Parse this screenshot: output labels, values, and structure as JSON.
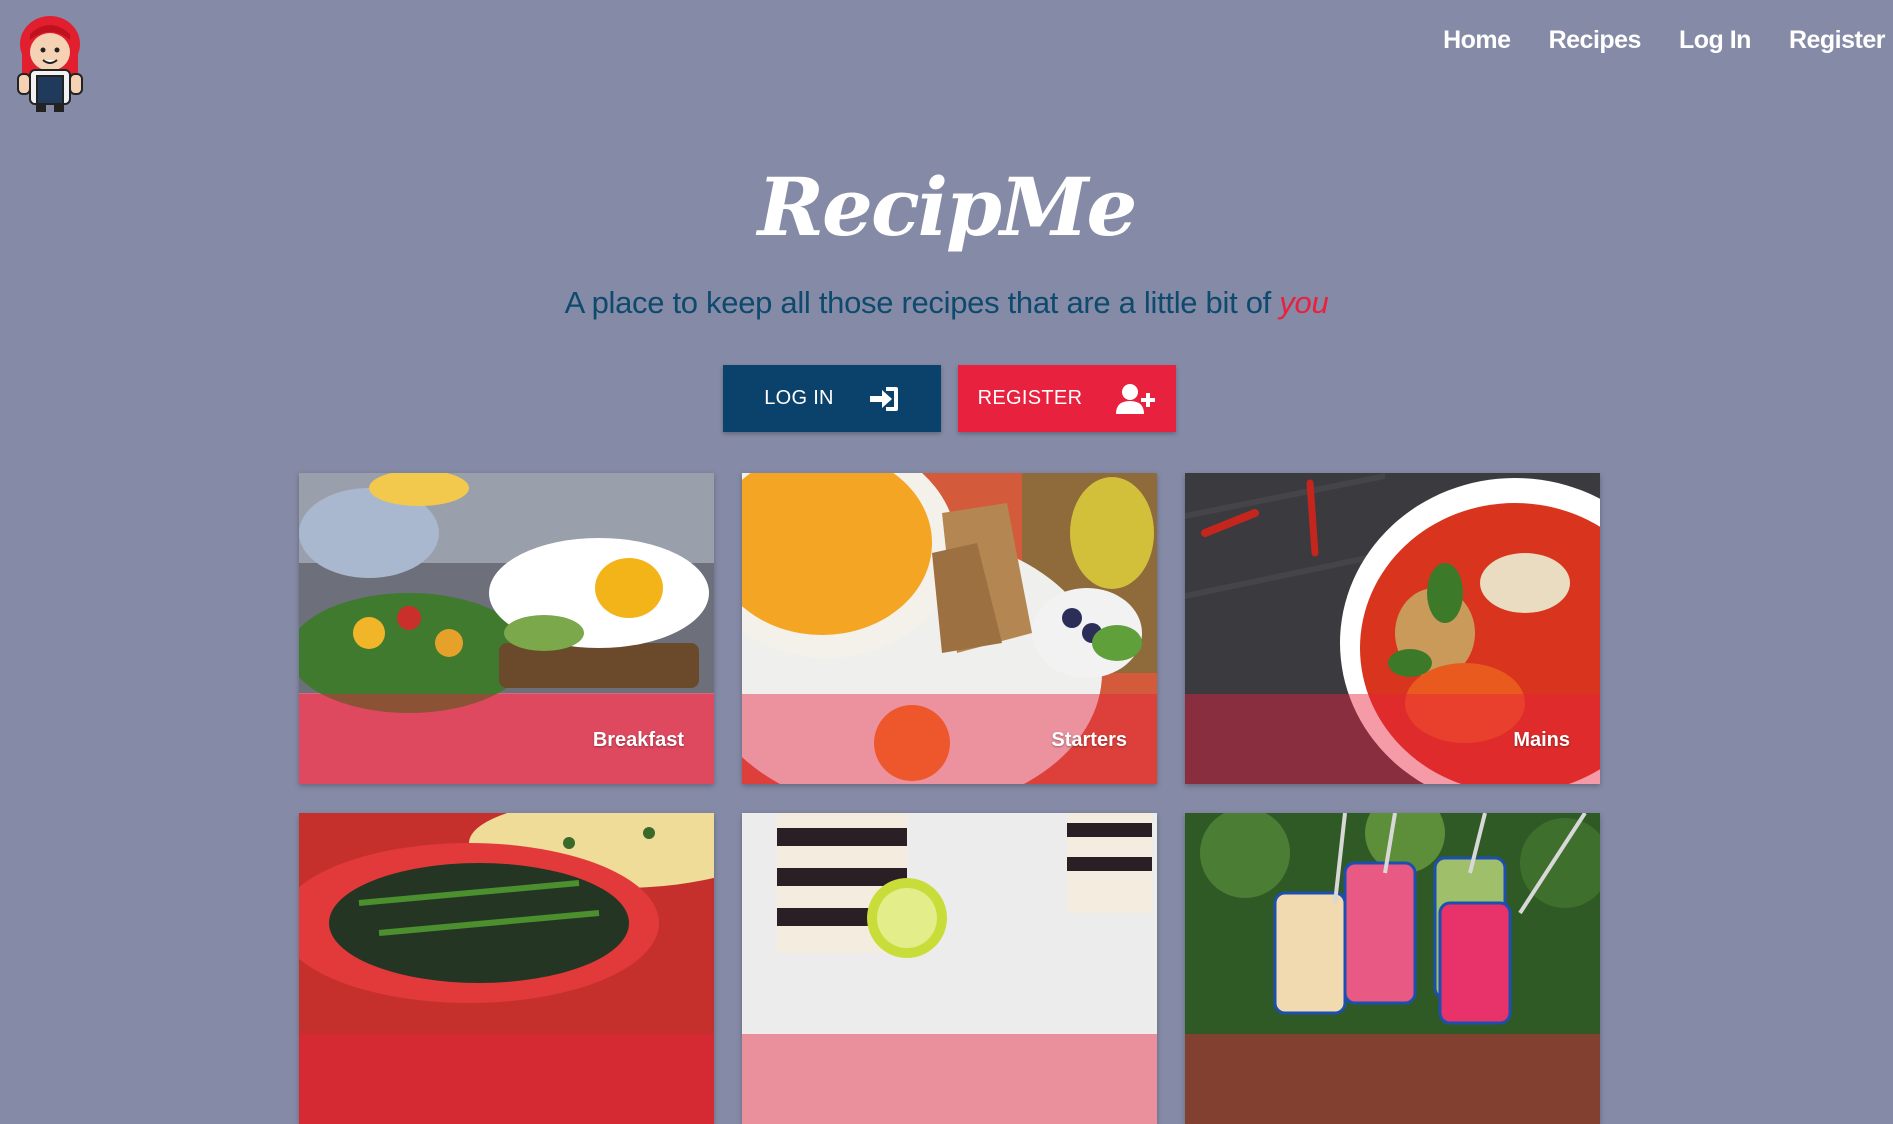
{
  "header": {
    "logo_icon": "chef-girl-mascot-icon",
    "nav": [
      {
        "label": "Home"
      },
      {
        "label": "Recipes"
      },
      {
        "label": "Log In"
      },
      {
        "label": "Register"
      }
    ]
  },
  "hero": {
    "title": "RecipMe",
    "tagline_main": "A place to keep all those recipes that are a little bit of",
    "tagline_accent": "you"
  },
  "actions": {
    "login_label": "LOG IN",
    "login_icon": "sign-in-icon",
    "register_label": "REGISTER",
    "register_icon": "user-plus-icon"
  },
  "categories": [
    {
      "label": "Breakfast"
    },
    {
      "label": "Starters"
    },
    {
      "label": "Mains"
    },
    {
      "label": ""
    },
    {
      "label": ""
    },
    {
      "label": ""
    }
  ],
  "colors": {
    "background": "#858aa6",
    "primary": "#0b426b",
    "accent": "#e8213f"
  }
}
